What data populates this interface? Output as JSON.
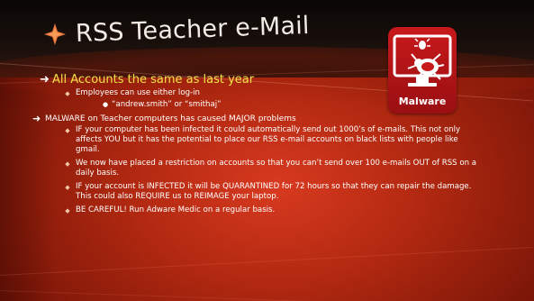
{
  "slide": {
    "title": "RSS Teacher e-Mail",
    "badge": {
      "label": "Malware",
      "icon": "bug-on-computer-icon",
      "color": "#c8191b"
    },
    "accent_color": "#f2e24a",
    "bullets": {
      "b1": "All Accounts the same as last year",
      "b1_sub1": "Employees can use either log-in",
      "b1_sub1_sub1": "“andrew.smith” or “smithaj”",
      "b2": "MALWARE on Teacher computers has caused MAJOR problems",
      "b2_sub1": "IF your computer has been infected it could automatically send out 1000’s of e-mails. This not only affects YOU but it has the potential to place our RSS e-mail accounts on black lists with people like gmail.",
      "b2_sub2": "We now have placed a restriction on accounts so that you can’t send over 100 e-mails OUT of RSS on a daily basis.",
      "b2_sub3": "IF your account is INFECTED it will be QUARANTINED for 72 hours so that they can repair the damage. This could also REQUIRE us to REIMAGE your laptop.",
      "b2_sub4": "BE CAREFUL! Run Adware Medic on a regular basis."
    }
  }
}
